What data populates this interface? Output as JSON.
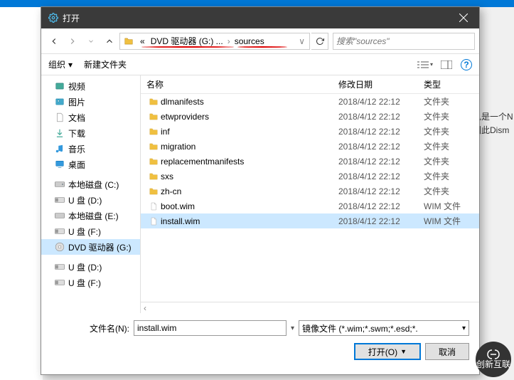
{
  "dialog": {
    "title": "打开",
    "breadcrumb": {
      "prefix": "«",
      "part1": "DVD 驱动器 (G:) ...",
      "part2": "sources"
    },
    "search_placeholder": "搜索\"sources\"",
    "toolbar": {
      "organize": "组织",
      "newfolder": "新建文件夹"
    },
    "columns": {
      "name": "名称",
      "date": "修改日期",
      "type": "类型"
    },
    "tree": [
      {
        "label": "视频",
        "icon": "video"
      },
      {
        "label": "图片",
        "icon": "pictures"
      },
      {
        "label": "文档",
        "icon": "docs"
      },
      {
        "label": "下载",
        "icon": "download"
      },
      {
        "label": "音乐",
        "icon": "music"
      },
      {
        "label": "桌面",
        "icon": "desktop"
      },
      {
        "label": "本地磁盘 (C:)",
        "icon": "sysdisk"
      },
      {
        "label": "U 盘 (D:)",
        "icon": "usb"
      },
      {
        "label": "本地磁盘 (E:)",
        "icon": "disk"
      },
      {
        "label": "U 盘 (F:)",
        "icon": "usb"
      },
      {
        "label": "DVD 驱动器 (G:)",
        "icon": "dvd",
        "selected": true
      },
      {
        "label": "U 盘 (D:)",
        "icon": "usb"
      },
      {
        "label": "U 盘 (F:)",
        "icon": "usb"
      }
    ],
    "files": [
      {
        "name": "dlmanifests",
        "date": "2018/4/12 22:12",
        "type": "文件夹",
        "icon": "folder"
      },
      {
        "name": "etwproviders",
        "date": "2018/4/12 22:12",
        "type": "文件夹",
        "icon": "folder"
      },
      {
        "name": "inf",
        "date": "2018/4/12 22:12",
        "type": "文件夹",
        "icon": "folder"
      },
      {
        "name": "migration",
        "date": "2018/4/12 22:12",
        "type": "文件夹",
        "icon": "folder"
      },
      {
        "name": "replacementmanifests",
        "date": "2018/4/12 22:12",
        "type": "文件夹",
        "icon": "folder"
      },
      {
        "name": "sxs",
        "date": "2018/4/12 22:12",
        "type": "文件夹",
        "icon": "folder"
      },
      {
        "name": "zh-cn",
        "date": "2018/4/12 22:12",
        "type": "文件夹",
        "icon": "folder"
      },
      {
        "name": "boot.wim",
        "date": "2018/4/12 22:12",
        "type": "WIM 文件",
        "icon": "file"
      },
      {
        "name": "install.wim",
        "date": "2018/4/12 22:12",
        "type": "WIM 文件",
        "icon": "file",
        "selected": true
      }
    ],
    "filename_label": "文件名(N):",
    "filename_value": "install.wim",
    "filter": "镜像文件 (*.wim;*.swm;*.esd;*.",
    "open_btn": "打开(O)",
    "cancel_btn": "取消"
  },
  "bg": {
    "line1": "见是一个N",
    "line2": "因此Dism"
  },
  "logo_text": "创新互联"
}
